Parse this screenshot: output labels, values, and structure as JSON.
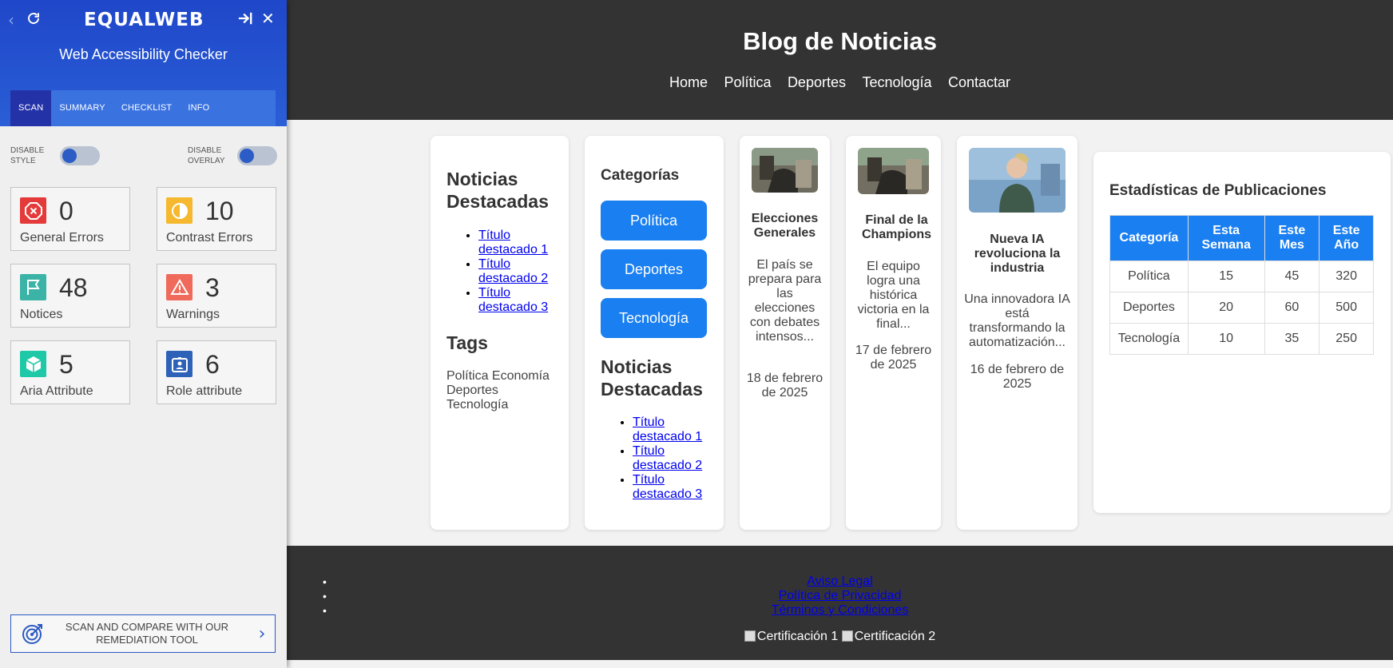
{
  "panel": {
    "logo": "EQUALWEB",
    "title": "Web Accessibility Checker",
    "tabs": [
      "SCAN",
      "SUMMARY",
      "CHECKLIST",
      "INFO"
    ],
    "toggles": [
      {
        "label": "DISABLE STYLE"
      },
      {
        "label": "DISABLE OVERLAY"
      }
    ],
    "cards": [
      {
        "value": "0",
        "label": "General Errors",
        "color": "#e53a3a",
        "icon": "error-x-icon"
      },
      {
        "value": "10",
        "label": "Contrast Errors",
        "color": "#f5b82e",
        "icon": "contrast-icon"
      },
      {
        "value": "48",
        "label": "Notices",
        "color": "#3bb3a6",
        "icon": "flag-icon"
      },
      {
        "value": "3",
        "label": "Warnings",
        "color": "#ef6a5b",
        "icon": "warning-triangle-icon"
      },
      {
        "value": "5",
        "label": "Aria Attribute",
        "color": "#1fc9a8",
        "icon": "cube-icon"
      },
      {
        "value": "6",
        "label": "Role attribute",
        "color": "#2e62b8",
        "icon": "id-card-icon"
      }
    ],
    "remediation": "SCAN AND COMPARE WITH OUR REMEDIATION TOOL"
  },
  "site": {
    "title": "Blog de Noticias",
    "nav": [
      "Home",
      "Política",
      "Deportes",
      "Tecnología",
      "Contactar"
    ],
    "featured1": {
      "heading": "Noticias Destacadas",
      "links": [
        "Título destacado 1",
        "Título destacado 2",
        "Título destacado 3"
      ]
    },
    "tags": {
      "heading": "Tags",
      "text": "Política Economía Deportes Tecnología"
    },
    "categories": {
      "heading": "Categorías",
      "buttons": [
        "Política",
        "Deportes",
        "Tecnología"
      ]
    },
    "featured2": {
      "heading": "Noticias Destacadas",
      "links": [
        "Título destacado 1",
        "Título destacado 2",
        "Título destacado 3"
      ]
    },
    "news": [
      {
        "title": "Elecciones Generales",
        "summary": "El país se prepara para las elecciones con debates intensos...",
        "date": "18 de febrero de 2025"
      },
      {
        "title": "Final de la Champions",
        "summary": "El equipo logra una histórica victoria en la final...",
        "date": "17 de febrero de 2025"
      },
      {
        "title": "Nueva IA revoluciona la industria",
        "summary": "Una innovadora IA está transformando la automatización...",
        "date": "16 de febrero de 2025"
      }
    ],
    "stats": {
      "heading": "Estadísticas de Publicaciones",
      "headers": [
        "Categoría",
        "Esta Semana",
        "Este Mes",
        "Este Año"
      ],
      "rows": [
        [
          "Política",
          "15",
          "45",
          "320"
        ],
        [
          "Deportes",
          "20",
          "60",
          "500"
        ],
        [
          "Tecnología",
          "10",
          "35",
          "250"
        ]
      ]
    },
    "footer": {
      "links": [
        "Aviso Legal",
        "Política de Privacidad",
        "Términos y Condiciones"
      ],
      "certs": [
        "Certificación 1",
        "Certificación 2"
      ]
    }
  }
}
